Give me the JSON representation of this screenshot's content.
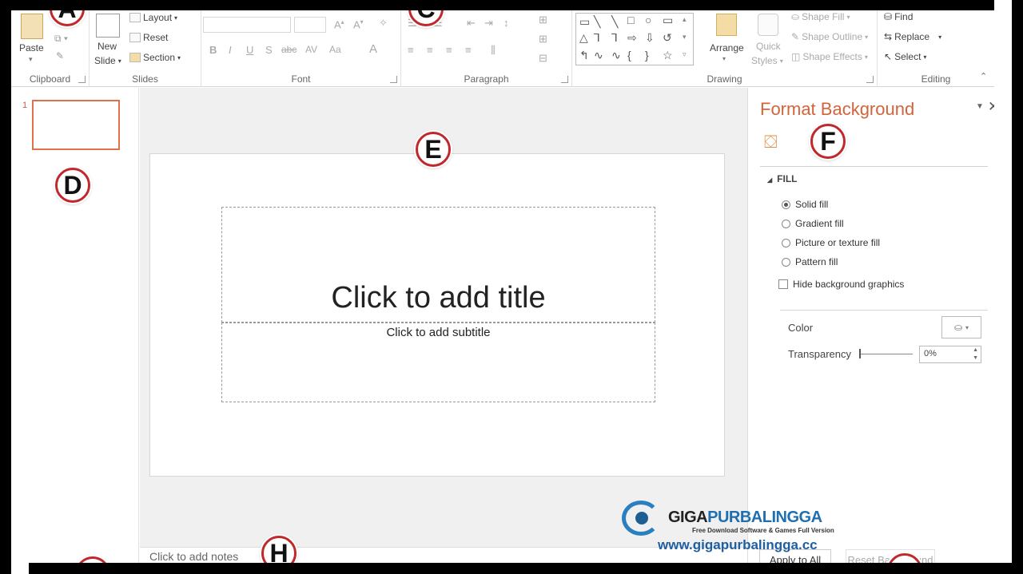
{
  "ribbon": {
    "clipboard": {
      "paste": "Paste",
      "label": "Clipboard"
    },
    "slides": {
      "new_slide": "New",
      "new_slide_2": "Slide",
      "layout": "Layout",
      "reset": "Reset",
      "section": "Section",
      "label": "Slides"
    },
    "font": {
      "label": "Font",
      "bold": "B",
      "italic": "I",
      "underline": "U",
      "strike": "S",
      "abc": "abc",
      "av": "AV",
      "aa": "Aa",
      "color_a": "A"
    },
    "paragraph": {
      "label": "Paragraph"
    },
    "drawing": {
      "arrange": "Arrange",
      "quick_styles": "Quick",
      "quick_styles_2": "Styles",
      "shape_fill": "Shape Fill",
      "shape_outline": "Shape Outline",
      "shape_effects": "Shape Effects",
      "label": "Drawing"
    },
    "editing": {
      "find": "Find",
      "replace": "Replace",
      "select": "Select",
      "label": "Editing"
    }
  },
  "annotations": {
    "a": "A",
    "c": "C",
    "d": "D",
    "e": "E",
    "f": "F",
    "h": "H"
  },
  "thumbnails": {
    "slide_number": "1"
  },
  "slide": {
    "title_placeholder": "Click to add title",
    "subtitle_placeholder": "Click to add subtitle"
  },
  "notes": {
    "placeholder": "Click to add notes"
  },
  "pane": {
    "title": "Format Background",
    "section": "FILL",
    "options": [
      "Solid fill",
      "Gradient fill",
      "Picture or texture fill",
      "Pattern fill"
    ],
    "hide_graphics": "Hide background graphics",
    "color_label": "Color",
    "transparency_label": "Transparency",
    "transparency_value": "0%",
    "apply_all": "Apply to All",
    "reset_background": "Reset Background"
  },
  "watermark": {
    "brand_1": "GIGA",
    "brand_2": "PURBALINGGA",
    "tagline": "Free Download Software & Games Full Version",
    "url": "www.gigapurbalingga.cc"
  },
  "colors": {
    "accent": "#d2643c",
    "annotation_ring": "#c0282c",
    "selection": "#e0704a"
  }
}
